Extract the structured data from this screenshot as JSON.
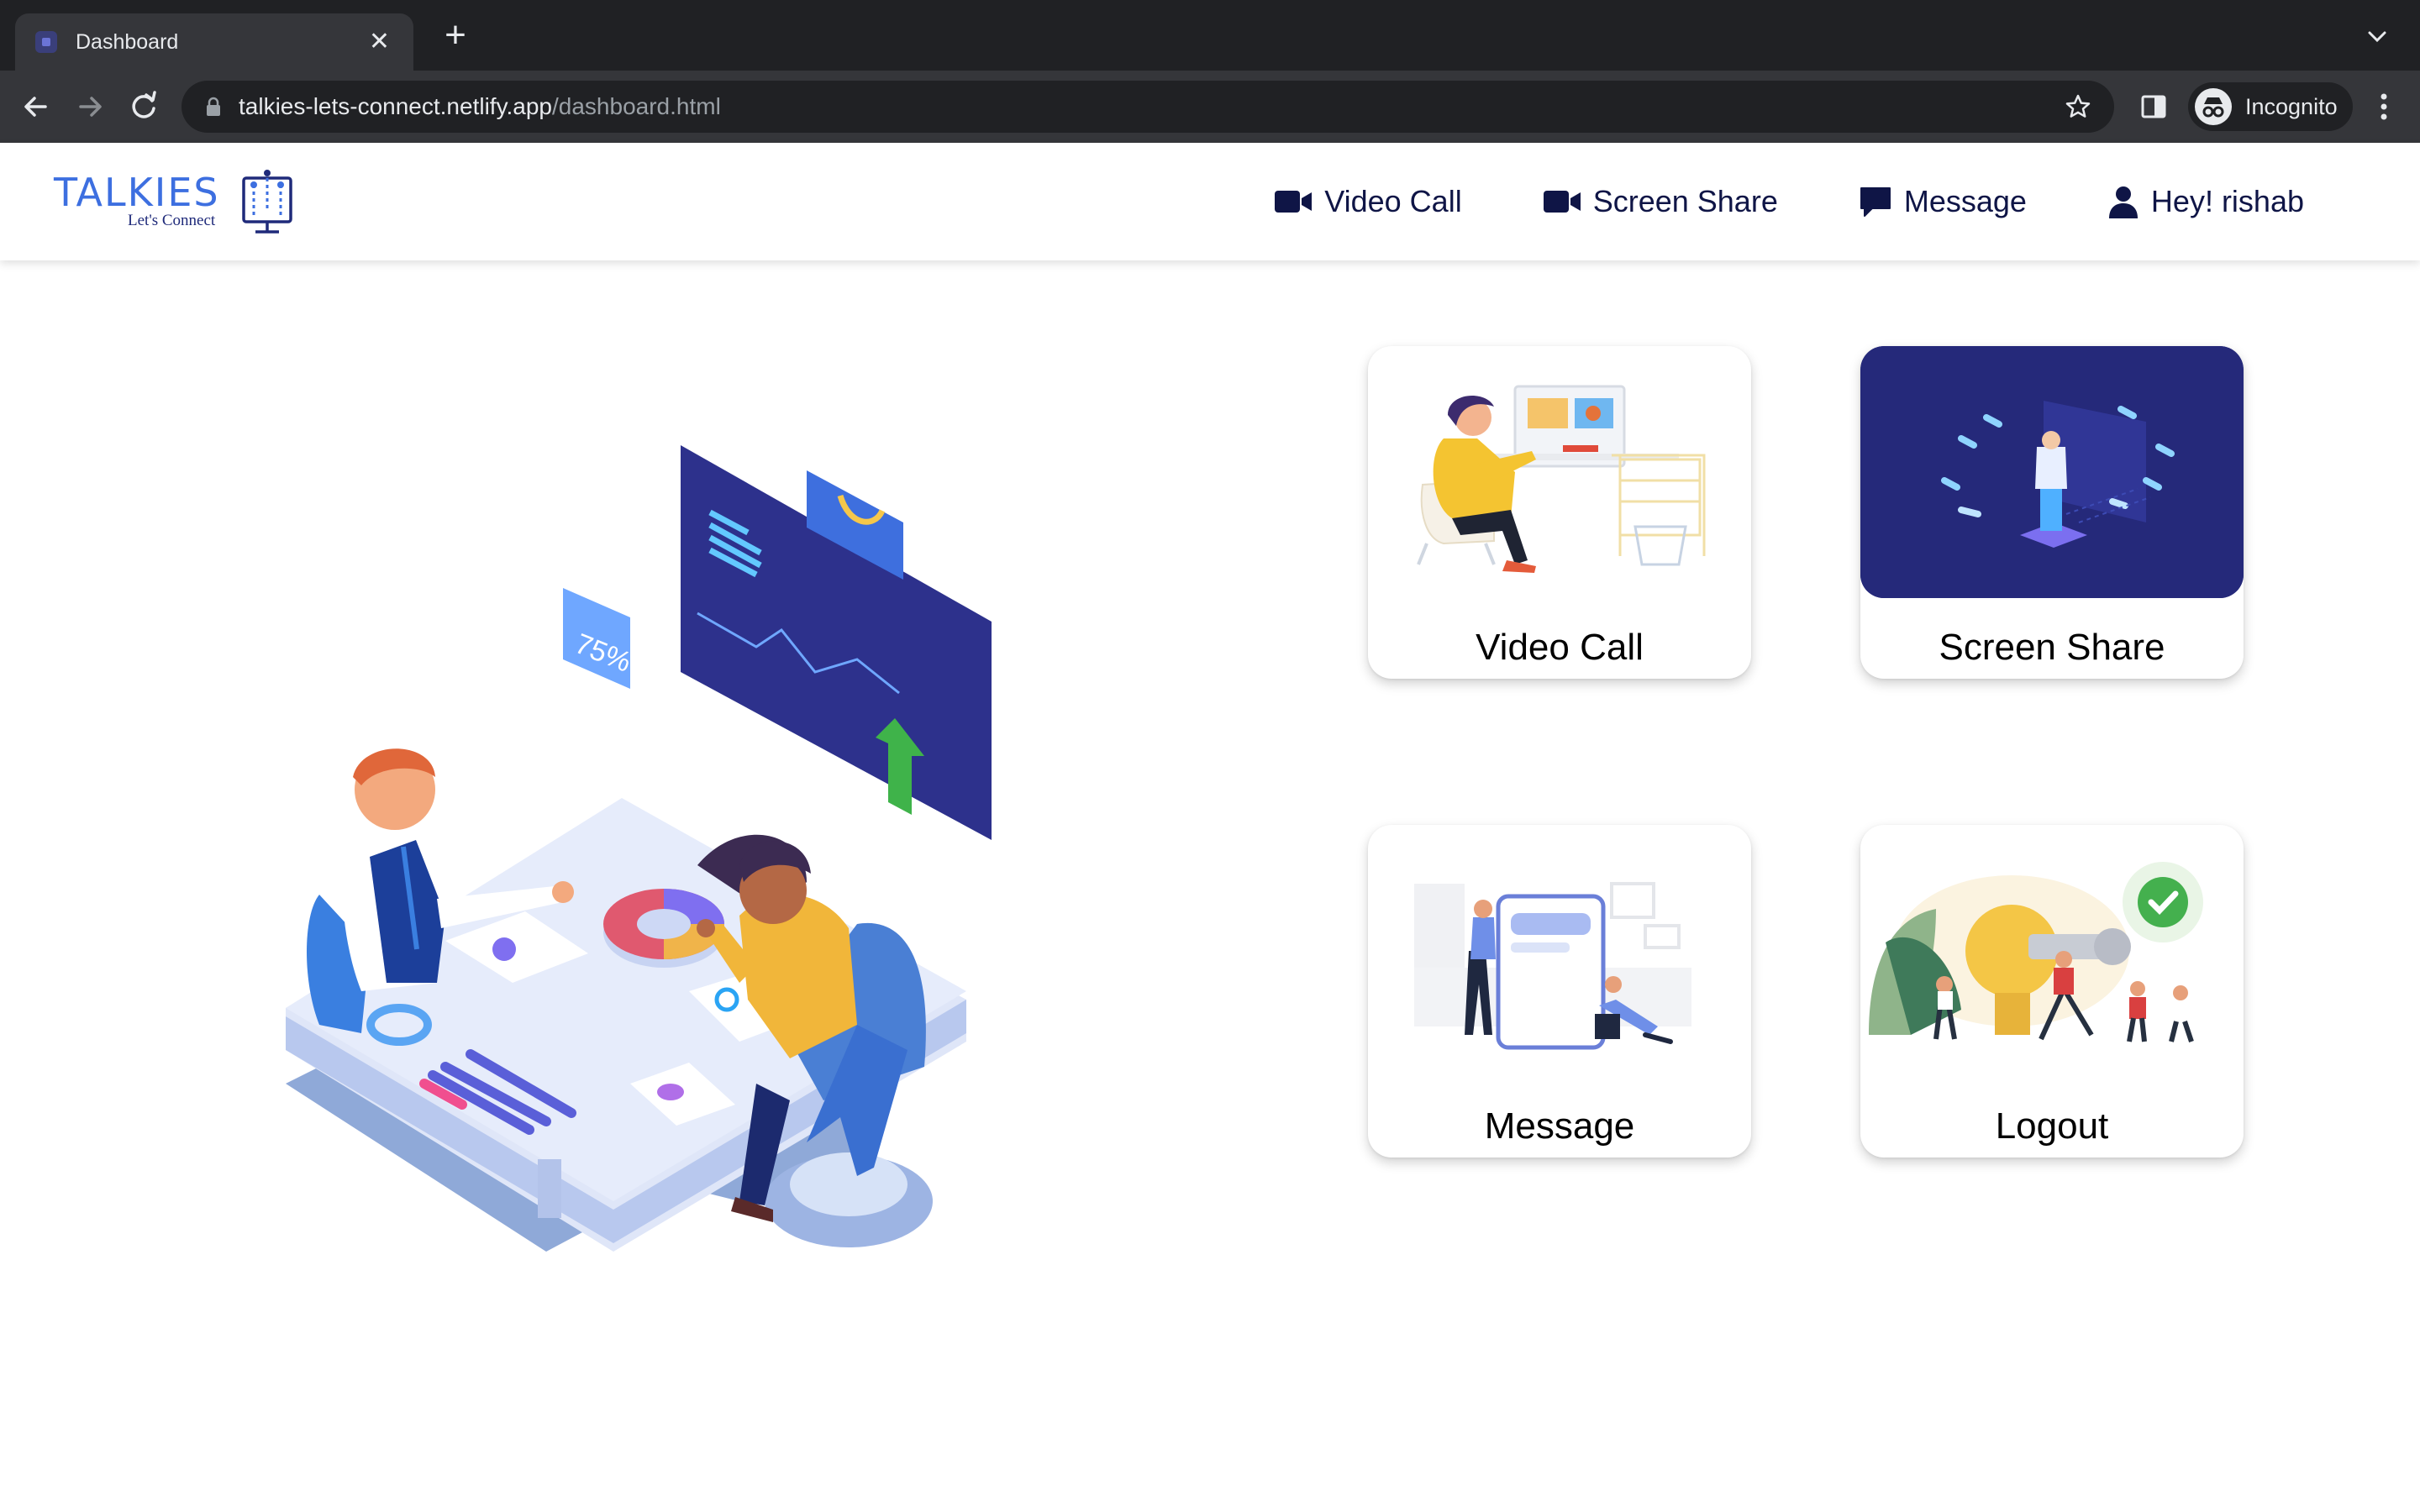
{
  "browser": {
    "tab_title": "Dashboard",
    "url_host": "talkies-lets-connect.netlify.app",
    "url_path": "/dashboard.html",
    "profile_label": "Incognito"
  },
  "site": {
    "logo_word": "TALKIES",
    "logo_tagline": "Let's Connect",
    "nav": [
      {
        "label": "Video Call",
        "icon": "video-camera-icon"
      },
      {
        "label": "Screen Share",
        "icon": "video-camera-icon"
      },
      {
        "label": "Message",
        "icon": "chat-bubble-icon"
      },
      {
        "label": "Hey! rishab",
        "icon": "user-icon"
      }
    ]
  },
  "cards": [
    {
      "label": "Video Call",
      "illustration": "person-on-video-call-illustration"
    },
    {
      "label": "Screen Share",
      "illustration": "screen-share-illustration"
    },
    {
      "label": "Message",
      "illustration": "messaging-illustration"
    },
    {
      "label": "Logout",
      "illustration": "logout-illustration"
    }
  ],
  "colors": {
    "brand_blue": "#3d6fe0",
    "nav_text": "#0f1546",
    "card_dark": "#25297a"
  }
}
